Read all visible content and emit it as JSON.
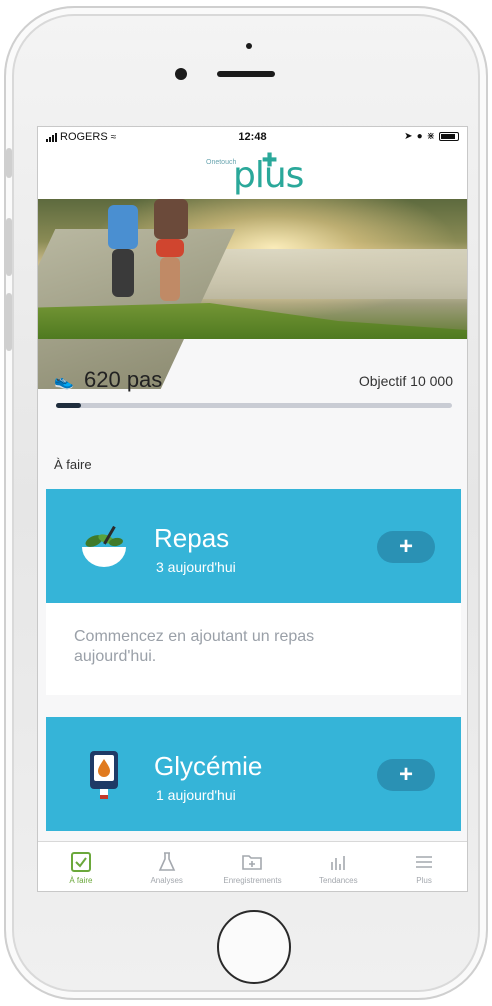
{
  "status_bar": {
    "carrier": "ROGERS",
    "time": "12:48"
  },
  "app": {
    "brand_small": "Onetouch",
    "brand_name": "plus"
  },
  "steps": {
    "count_label": "620 pas",
    "goal_label": "Objectif 10 000",
    "progress_fraction": 0.062
  },
  "section": {
    "label": "À faire"
  },
  "cards": [
    {
      "title": "Repas",
      "subtitle": "3 aujourd'hui",
      "add_label": "+",
      "icon": "salad-bowl-icon",
      "color": "#35b4d8"
    },
    {
      "title": "Glycémie",
      "subtitle": "1 aujourd'hui",
      "add_label": "+",
      "icon": "glucose-meter-icon",
      "color": "#35b4d8"
    }
  ],
  "note": {
    "text": "Commencez en ajoutant un repas aujourd'hui."
  },
  "tabs": [
    {
      "label": "À faire",
      "icon": "checkbox-icon",
      "active": true
    },
    {
      "label": "Analyses",
      "icon": "flask-icon",
      "active": false
    },
    {
      "label": "Enregistrements",
      "icon": "folder-add-icon",
      "active": false
    },
    {
      "label": "Tendances",
      "icon": "bar-chart-icon",
      "active": false
    },
    {
      "label": "Plus",
      "icon": "menu-icon",
      "active": false
    }
  ],
  "colors": {
    "accent_green": "#6ba83b",
    "card_blue": "#35b4d8",
    "brand_teal": "#2aa89a"
  }
}
